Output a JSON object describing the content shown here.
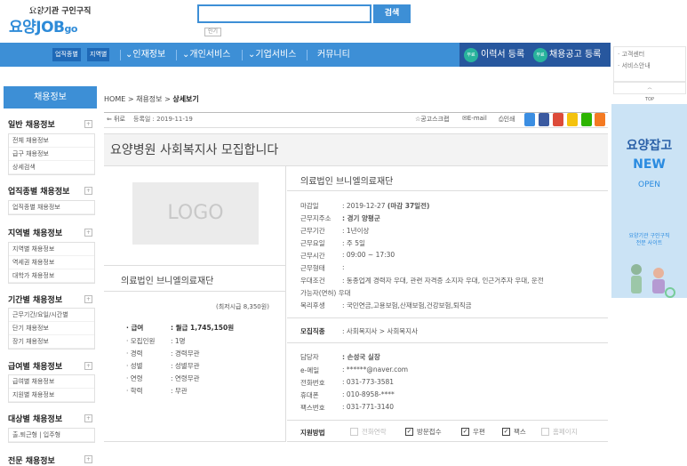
{
  "header": {
    "logo_top": "요양기관 구인구직",
    "logo_main": "요양JOB",
    "logo_go": "go",
    "search_value": "",
    "search_button": "검색",
    "search_hint": "인기"
  },
  "nav": {
    "items": [
      {
        "label": "채용정보"
      },
      {
        "label": "업직종별"
      },
      {
        "label": "지역별"
      },
      {
        "label": "인재정보"
      },
      {
        "label": "개인서비스"
      },
      {
        "label": "기업서비스"
      },
      {
        "label": "커뮤니티"
      }
    ],
    "free_badge": "무료",
    "resume_reg": "이력서 등록",
    "job_reg": "채용공고 등록"
  },
  "right": {
    "links": [
      "· 고객센터",
      "· 서비스안내"
    ],
    "top": "TOP",
    "banner": {
      "line1": "요양잡고",
      "line2": "NEW",
      "line3": "OPEN",
      "line4": "요양기관 구인구직",
      "line5": "전문 사이트"
    }
  },
  "sidebar": {
    "head": "채용정보",
    "sections": [
      {
        "title": "일반 채용정보",
        "links": [
          "전체 채용정보",
          "급구 채용정보",
          "상세검색"
        ]
      },
      {
        "title": "업직종별 채용정보",
        "links": [
          "업직종별 채용정보"
        ]
      },
      {
        "title": "지역별 채용정보",
        "links": [
          "지역별 채용정보",
          "역세권 채용정보",
          "대학가 채용정보"
        ]
      },
      {
        "title": "기간별 채용정보",
        "links": [
          "근무기간/요일/시간별",
          "단기 채용정보",
          "장기 채용정보"
        ]
      },
      {
        "title": "급여별 채용정보",
        "links": [
          "급여별 채용정보",
          "지원별 채용정보"
        ]
      },
      {
        "title": "대상별 채용정보",
        "links": [
          "출.퇴근형 | 입주형"
        ]
      },
      {
        "title": "전문 채용정보",
        "links": []
      }
    ],
    "plus": "+"
  },
  "content": {
    "breadcrumb": {
      "home": "HOME",
      "sep": ">",
      "section": "채용정보",
      "page": "상세보기"
    },
    "toolbar": {
      "back": "뒤로",
      "reg_date_label": "등록일 : 2019-11-19",
      "scrap": "공고스크랩",
      "email": "E-mail",
      "print": "인쇄"
    },
    "title": "요양병원 사회복지사 모집합니다",
    "logo_placeholder": "LOGO",
    "company": "의료법인 브니엘의료재단",
    "min_wage": "(최저시급 8,350원)",
    "conditions": [
      {
        "label": "· 급여",
        "value": ": 월급 1,745,150원",
        "bold": true
      },
      {
        "label": "· 모집인원",
        "value": ": 1명"
      },
      {
        "label": "· 경력",
        "value": ": 경력무관"
      },
      {
        "label": "· 성별",
        "value": ": 성별무관"
      },
      {
        "label": "· 연령",
        "value": ": 연령무관"
      },
      {
        "label": "· 학력",
        "value": ": 무관"
      }
    ],
    "details": [
      {
        "label": "마감일",
        "value": ": 2019-12-27 (마감 37일전)",
        "boldpart": "(마감 37일전)"
      },
      {
        "label": "근무지주소",
        "value": ": 경기 양평군"
      },
      {
        "label": "근무기간",
        "value": ": 1년이상"
      },
      {
        "label": "근무요일",
        "value": ": 주 5일"
      },
      {
        "label": "근무시간",
        "value": ": 09:00 ~ 17:30"
      },
      {
        "label": "근무형태",
        "value": ":"
      },
      {
        "label": "우대조건",
        "value": ": 동종업계 경력자 우대, 관련 자격증 소지자 우대, 인근거주자 우대, 운전"
      },
      {
        "label": "",
        "value": "가능자(면허) 우대"
      },
      {
        "label": "복리후생",
        "value": ": 국민연금,고용보험,산재보험,건강보험,퇴직금"
      }
    ],
    "job_type_label": "모집직종",
    "job_type_value": ": 사회복지사 > 사회복지사",
    "contacts": [
      {
        "label": "담당자",
        "value": ": 손성국 실장"
      },
      {
        "label": "e-메일",
        "value": ": ******@naver.com"
      },
      {
        "label": "전화번호",
        "value": ": 031-773-3581"
      },
      {
        "label": "휴대폰",
        "value": ": 010-8958-****"
      },
      {
        "label": "팩스번호",
        "value": ": 031-771-3140"
      }
    ],
    "apply_label": "지원방법",
    "apply_methods": [
      {
        "label": "전화연락",
        "checked": false
      },
      {
        "label": "방문접수",
        "checked": true
      },
      {
        "label": "우편",
        "checked": true
      },
      {
        "label": "팩스",
        "checked": true
      },
      {
        "label": "홈페이지",
        "checked": false
      }
    ]
  }
}
